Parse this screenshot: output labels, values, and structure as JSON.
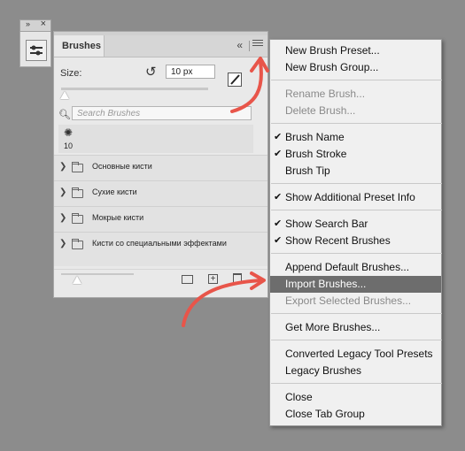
{
  "mini_panel": {
    "collapse_glyph": "»",
    "close_glyph": "×",
    "tool_icon": "brush-settings-icon"
  },
  "panel": {
    "tab_label": "Brushes",
    "collapse_glyph": "«",
    "size_label": "Size:",
    "size_value": "10 px",
    "search_placeholder": "Search Brushes",
    "recent_brush_size": "10",
    "groups": [
      "Основные кисти",
      "Сухие кисти",
      "Мокрые кисти",
      "Кисти со специальными эффектами"
    ]
  },
  "menu": {
    "items": [
      {
        "label": "New Brush Preset...",
        "checked": false,
        "disabled": false
      },
      {
        "label": "New Brush Group...",
        "checked": false,
        "disabled": false
      },
      {
        "label": "Rename Brush...",
        "checked": false,
        "disabled": true
      },
      {
        "label": "Delete Brush...",
        "checked": false,
        "disabled": true
      },
      {
        "label": "Brush Name",
        "checked": true,
        "disabled": false
      },
      {
        "label": "Brush Stroke",
        "checked": true,
        "disabled": false
      },
      {
        "label": "Brush Tip",
        "checked": false,
        "disabled": false
      },
      {
        "label": "Show Additional Preset Info",
        "checked": true,
        "disabled": false
      },
      {
        "label": "Show Search Bar",
        "checked": true,
        "disabled": false
      },
      {
        "label": "Show Recent Brushes",
        "checked": true,
        "disabled": false
      },
      {
        "label": "Append Default Brushes...",
        "checked": false,
        "disabled": false
      },
      {
        "label": "Import Brushes...",
        "checked": false,
        "disabled": false,
        "highlighted": true
      },
      {
        "label": "Export Selected Brushes...",
        "checked": false,
        "disabled": true
      },
      {
        "label": "Get More Brushes...",
        "checked": false,
        "disabled": false
      },
      {
        "label": "Converted Legacy Tool Presets",
        "checked": false,
        "disabled": false
      },
      {
        "label": "Legacy Brushes",
        "checked": false,
        "disabled": false
      },
      {
        "label": "Close",
        "checked": false,
        "disabled": false
      },
      {
        "label": "Close Tab Group",
        "checked": false,
        "disabled": false
      }
    ],
    "check_glyph": "✔"
  },
  "colors": {
    "background": "#8c8c8c",
    "highlight": "#6d6d6d",
    "annotation": "#e8554a"
  }
}
